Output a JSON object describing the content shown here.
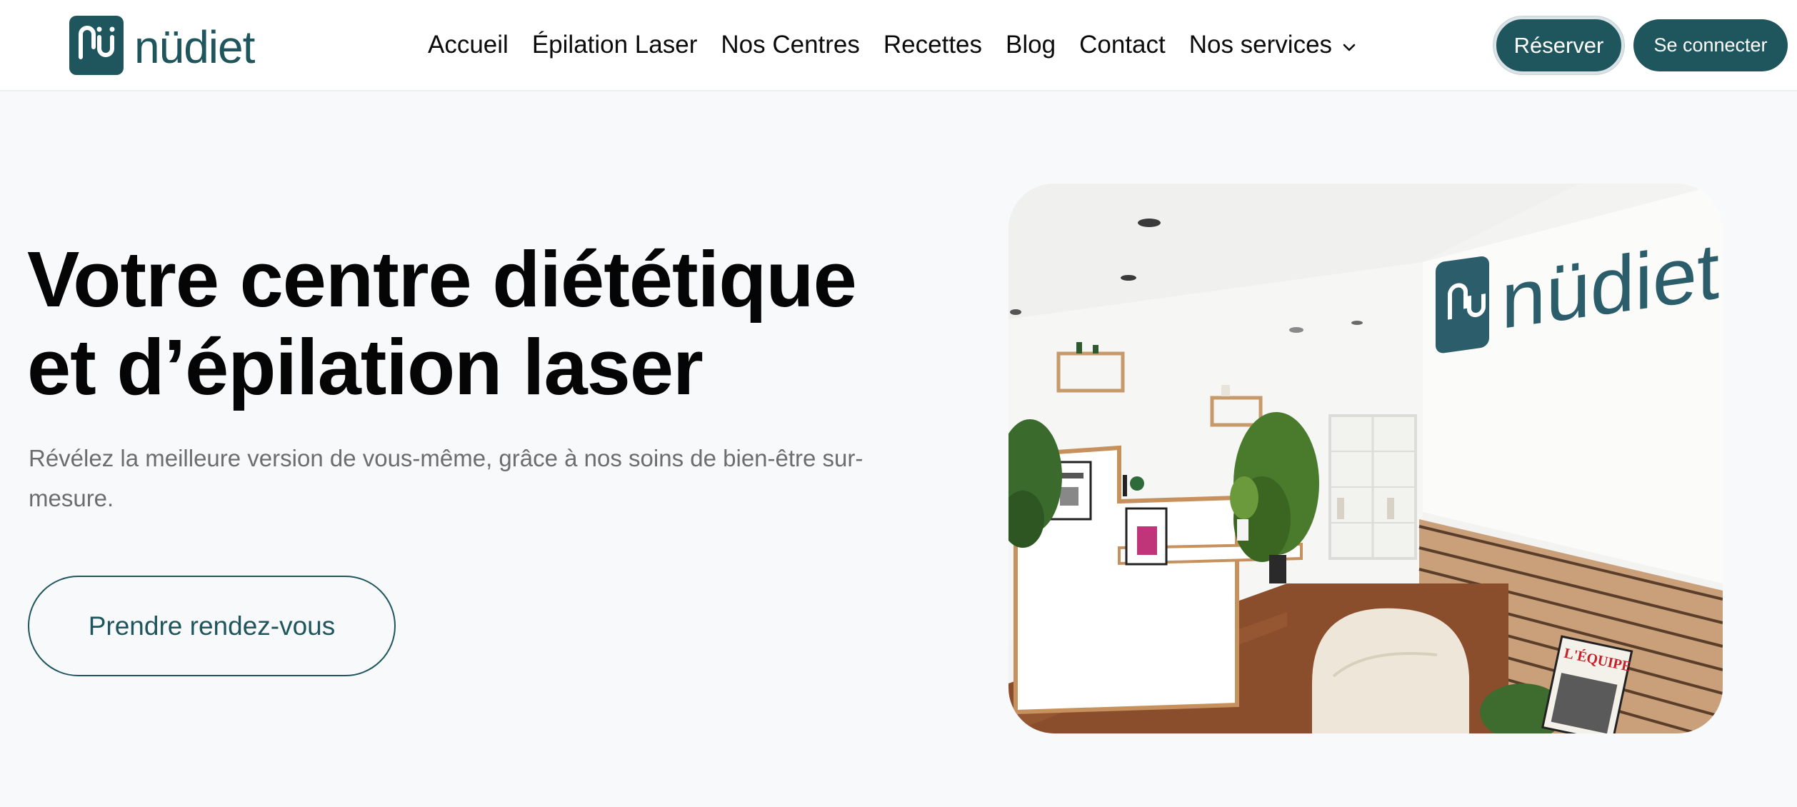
{
  "brand": {
    "name": "nüdiet",
    "color": "#1f555d"
  },
  "nav": {
    "items": [
      {
        "label": "Accueil"
      },
      {
        "label": "Épilation Laser"
      },
      {
        "label": "Nos Centres"
      },
      {
        "label": "Recettes"
      },
      {
        "label": "Blog"
      },
      {
        "label": "Contact"
      },
      {
        "label": "Nos services",
        "icon": "chevron-down-icon"
      }
    ]
  },
  "header_actions": {
    "reserve_label": "Réserver",
    "login_label": "Se connecter"
  },
  "hero": {
    "title_line1": "Votre centre diététique",
    "title_line2": "et d’épilation laser",
    "subtitle": "Révélez la meilleure version de vous-même, grâce à nos soins de bien-être sur-mesure.",
    "cta_label": "Prendre rendez-vous"
  },
  "photo": {
    "wall_sign": "nüdiet",
    "poster_text": "L'ÉQUIPE"
  }
}
